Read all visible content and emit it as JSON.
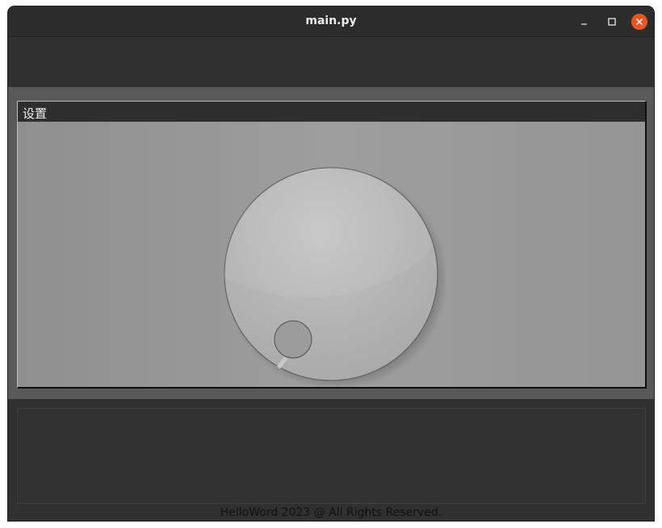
{
  "window": {
    "title": "main.py",
    "controls": {
      "minimize": "minimize-icon",
      "maximize": "maximize-icon",
      "close": "close-icon"
    },
    "close_color": "#e95420"
  },
  "settings_group": {
    "title": "设置"
  },
  "dial": {
    "value": 0.0
  },
  "footer": {
    "text": "HelloWord 2023 @ All Rights Reserved."
  }
}
